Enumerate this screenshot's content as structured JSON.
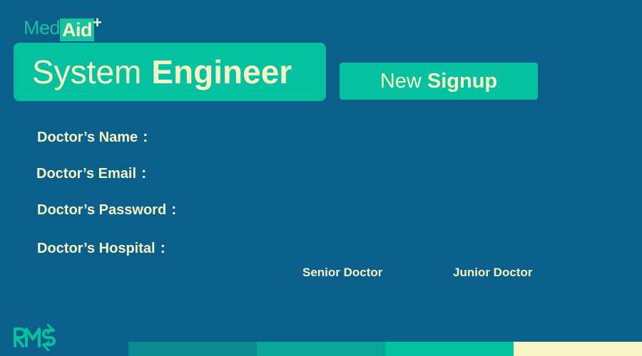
{
  "logo": {
    "part1": "Med",
    "part2": "Aid",
    "plus": "+"
  },
  "header": {
    "title_light": "System",
    "title_bold": "Engineer"
  },
  "signup": {
    "light": "New",
    "bold": "Signup"
  },
  "form": {
    "fields": [
      {
        "label": "Doctor’s Name",
        "colon": ":"
      },
      {
        "label": "Doctor’s Email",
        "colon": ":"
      },
      {
        "label": "Doctor’s Password",
        "colon": ":"
      },
      {
        "label": "Doctor’s Hospital",
        "colon": ":"
      }
    ]
  },
  "roles": [
    "Senior Doctor",
    "Junior Doctor"
  ],
  "colors": {
    "background": "#0b5f8b",
    "accent": "#04c2a0",
    "text": "#f6f3c5",
    "bars": [
      "#0b8a91",
      "#0aa596",
      "#04c2a0",
      "#f6f3c5"
    ]
  },
  "icons": {
    "brand": "rms-logo-icon"
  }
}
